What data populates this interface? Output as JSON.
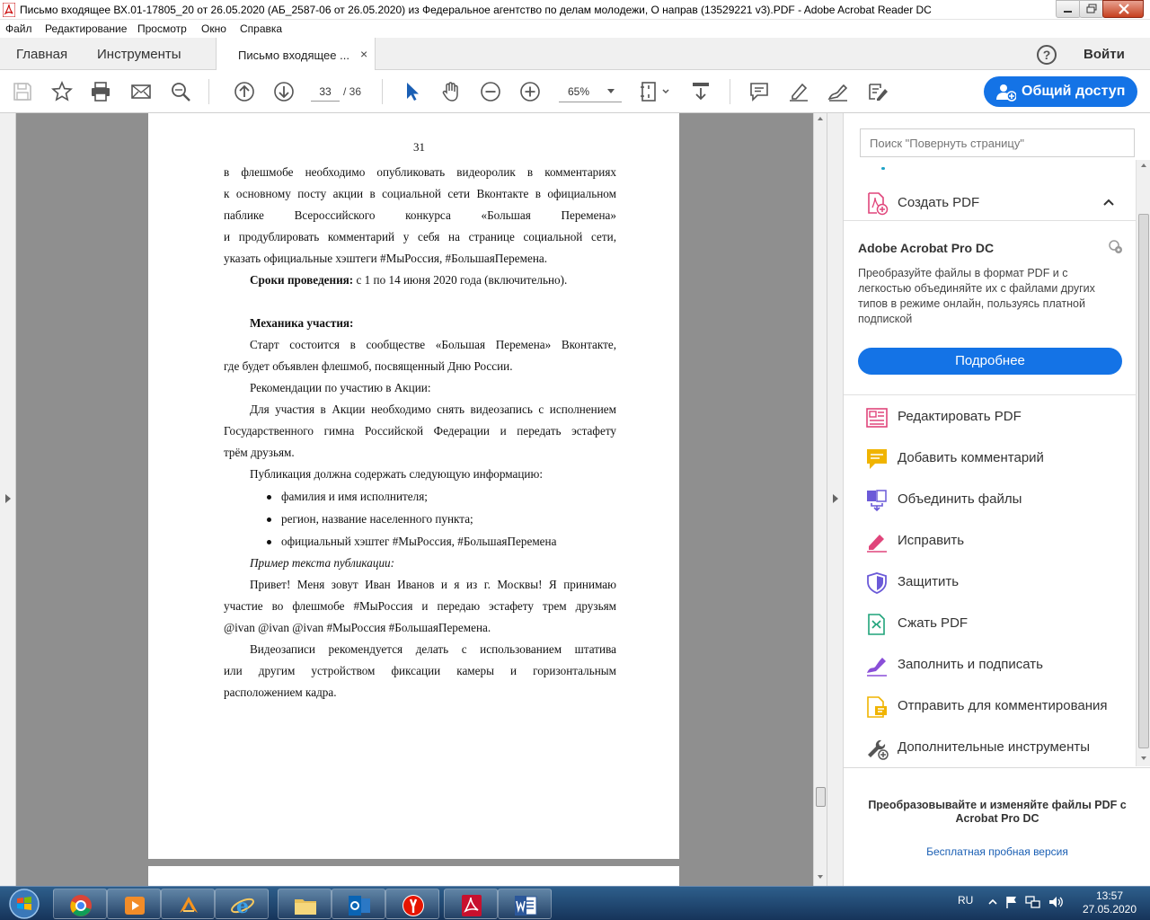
{
  "window": {
    "title": "Письмо входящее ВХ.01-17805_20 от 26.05.2020 (АБ_2587-06 от 26.05.2020) из Федеральное агентство по делам молодежи,  О направ (13529221 v3).PDF - Adobe Acrobat Reader DC"
  },
  "menu": [
    "Файл",
    "Редактирование",
    "Просмотр",
    "Окно",
    "Справка"
  ],
  "tabs": {
    "home": "Главная",
    "tools": "Инструменты",
    "document": "Письмо входящее ...",
    "close": "×",
    "help": "?",
    "signin": "Войти"
  },
  "toolbar": {
    "current_page": "33",
    "total_pages": "/ 36",
    "zoom": "65%",
    "share_label": "Общий доступ",
    "icons": [
      "save-icon",
      "star-icon",
      "print-icon",
      "email-icon",
      "search-icon",
      "page-up-icon",
      "page-down-icon",
      "select-arrow-icon",
      "hand-icon",
      "zoom-out-icon",
      "zoom-in-icon",
      "page-fit-icon",
      "scroll-mode-icon",
      "comment-icon",
      "highlight-icon",
      "sign-icon",
      "fill-sign-icon"
    ]
  },
  "document": {
    "page_number": "31",
    "lines": {
      "l1": "в флешмобе необходимо опубликовать видеоролик в комментариях",
      "l2": "к основному посту акции в социальной сети Вконтакте в официальном",
      "l3": "паблике Всероссийского конкурса «Большая Перемена»",
      "l4": "и продублировать комментарий у себя на странице социальной сети,",
      "l5": "указать официальные хэштеги #МыРоссия, #БольшаяПеремена.",
      "l6_bold": "Сроки проведения:",
      "l6_rest": " с 1 по 14 июня 2020 года (включительно).",
      "l7_bold": "Механика участия:",
      "l8": "Старт состоится в сообществе «Большая Перемена» Вконтакте,",
      "l9": "где будет объявлен флешмоб, посвященный Дню России.",
      "l10": "Рекомендации по участию в Акции:",
      "l11": "Для участия в Акции необходимо снять видеозапись с исполнением",
      "l12": "Государственного гимна Российской Федерации и передать эстафету",
      "l13": "трём друзьям.",
      "l14": "Публикация должна содержать следующую информацию:",
      "b1": "фамилия и имя исполнителя;",
      "b2": "регион, название населенного пункта;",
      "b3": "официальный хэштег #МыРоссия, #БольшаяПеремена",
      "l15_italic": "Пример текста публикации:",
      "l16": "Привет! Меня зовут Иван Иванов и я из г. Москвы! Я принимаю",
      "l17": "участие во флешмобе #МыРоссия и передаю эстафету трем друзьям",
      "l18": "@ivan @ivan @ivan #МыРоссия #БольшаяПеремена.",
      "l19": "Видеозаписи рекомендуется делать с использованием штатива",
      "l20": "или другим устройством фиксации камеры и горизонтальным",
      "l21": "расположением кадра."
    }
  },
  "tools_pane": {
    "search_placeholder": "Поиск \"Повернуть страницу\"",
    "create_pdf": "Создать PDF",
    "promo": {
      "title": "Adobe Acrobat Pro DC",
      "text": "Преобразуйте файлы в формат PDF и с легкостью объединяйте их с файлами других типов в режиме онлайн, пользуясь платной подпиской",
      "button": "Подробнее"
    },
    "tools": [
      {
        "label": "Редактировать PDF",
        "icon": "edit-pdf-icon",
        "color": "#e0457b"
      },
      {
        "label": "Добавить комментарий",
        "icon": "comment-icon",
        "color": "#f0b400"
      },
      {
        "label": "Объединить файлы",
        "icon": "combine-files-icon",
        "color": "#6b5ad8"
      },
      {
        "label": "Исправить",
        "icon": "redact-icon",
        "color": "#e0457b"
      },
      {
        "label": "Защитить",
        "icon": "protect-icon",
        "color": "#6b5ad8"
      },
      {
        "label": "Сжать PDF",
        "icon": "compress-icon",
        "color": "#1fa37a"
      },
      {
        "label": "Заполнить и подписать",
        "icon": "fill-sign-icon",
        "color": "#8a4fd8"
      },
      {
        "label": "Отправить для комментирования",
        "icon": "send-review-icon",
        "color": "#f0b400"
      },
      {
        "label": "Дополнительные инструменты",
        "icon": "more-tools-icon",
        "color": "#555555"
      }
    ],
    "footer_text": "Преобразовывайте и изменяйте файлы PDF с Acrobat Pro DC",
    "footer_link": "Бесплатная пробная версия"
  },
  "taskbar": {
    "apps": [
      "chrome-icon",
      "media-player-icon",
      "aimp-icon",
      "internet-explorer-icon",
      "file-explorer-icon",
      "outlook-icon",
      "yandex-browser-icon",
      "acrobat-icon",
      "word-icon"
    ],
    "lang": "RU",
    "time": "13:57",
    "date": "27.05.2020"
  },
  "colors": {
    "accent": "#1473e6",
    "doc_bg": "#8f8f8f",
    "taskbar": "#1f466f"
  }
}
